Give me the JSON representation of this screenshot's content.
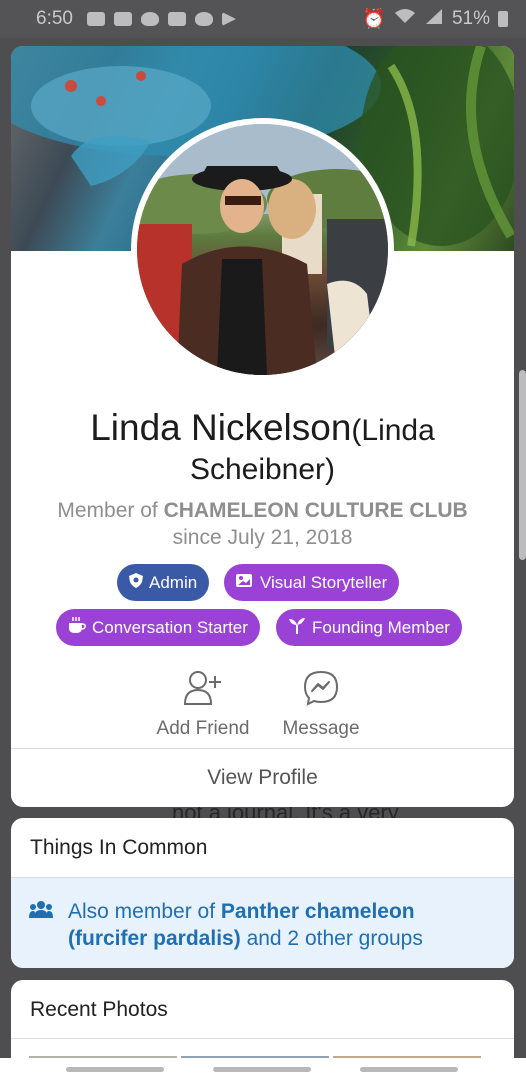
{
  "status_bar": {
    "time": "6:50",
    "battery": "51%",
    "left_icons": [
      "youtube-icon",
      "gallery-icon",
      "twitter-icon",
      "news-icon",
      "twitter-icon",
      "play-store-icon"
    ],
    "right_icons": [
      "alarm-icon",
      "wifi-icon",
      "signal-icon",
      "battery-icon"
    ]
  },
  "background": {
    "text": "not a journal. It's a very"
  },
  "profile": {
    "name": "Linda Nickelson",
    "maiden_part1": "(Linda",
    "maiden_part2": "Scheibner)",
    "member_prefix": "Member of",
    "group_name": "CHAMELEON CULTURE CLUB",
    "since": "since July 21, 2018",
    "badges": [
      {
        "label": "Admin",
        "icon": "shield-star-icon",
        "color": "#3a5aa8"
      },
      {
        "label": "Visual Storyteller",
        "icon": "photos-icon",
        "color": "#9b42d6"
      },
      {
        "label": "Conversation Starter",
        "icon": "coffee-icon",
        "color": "#9b42d6"
      },
      {
        "label": "Founding Member",
        "icon": "sprout-icon",
        "color": "#9b42d6"
      }
    ],
    "actions": {
      "add_friend": "Add Friend",
      "message": "Message"
    },
    "view_profile": "View Profile"
  },
  "common": {
    "title": "Things In Common",
    "prefix": "Also member of",
    "group": "Panther chameleon (furcifer pardalis)",
    "suffix": "and 2 other groups"
  },
  "recent": {
    "title": "Recent Photos"
  },
  "colors": {
    "admin_badge": "#3a5aa8",
    "purple_badge": "#9b42d6",
    "link_blue": "#1f6fb5",
    "common_bg": "#e7f2fc"
  }
}
